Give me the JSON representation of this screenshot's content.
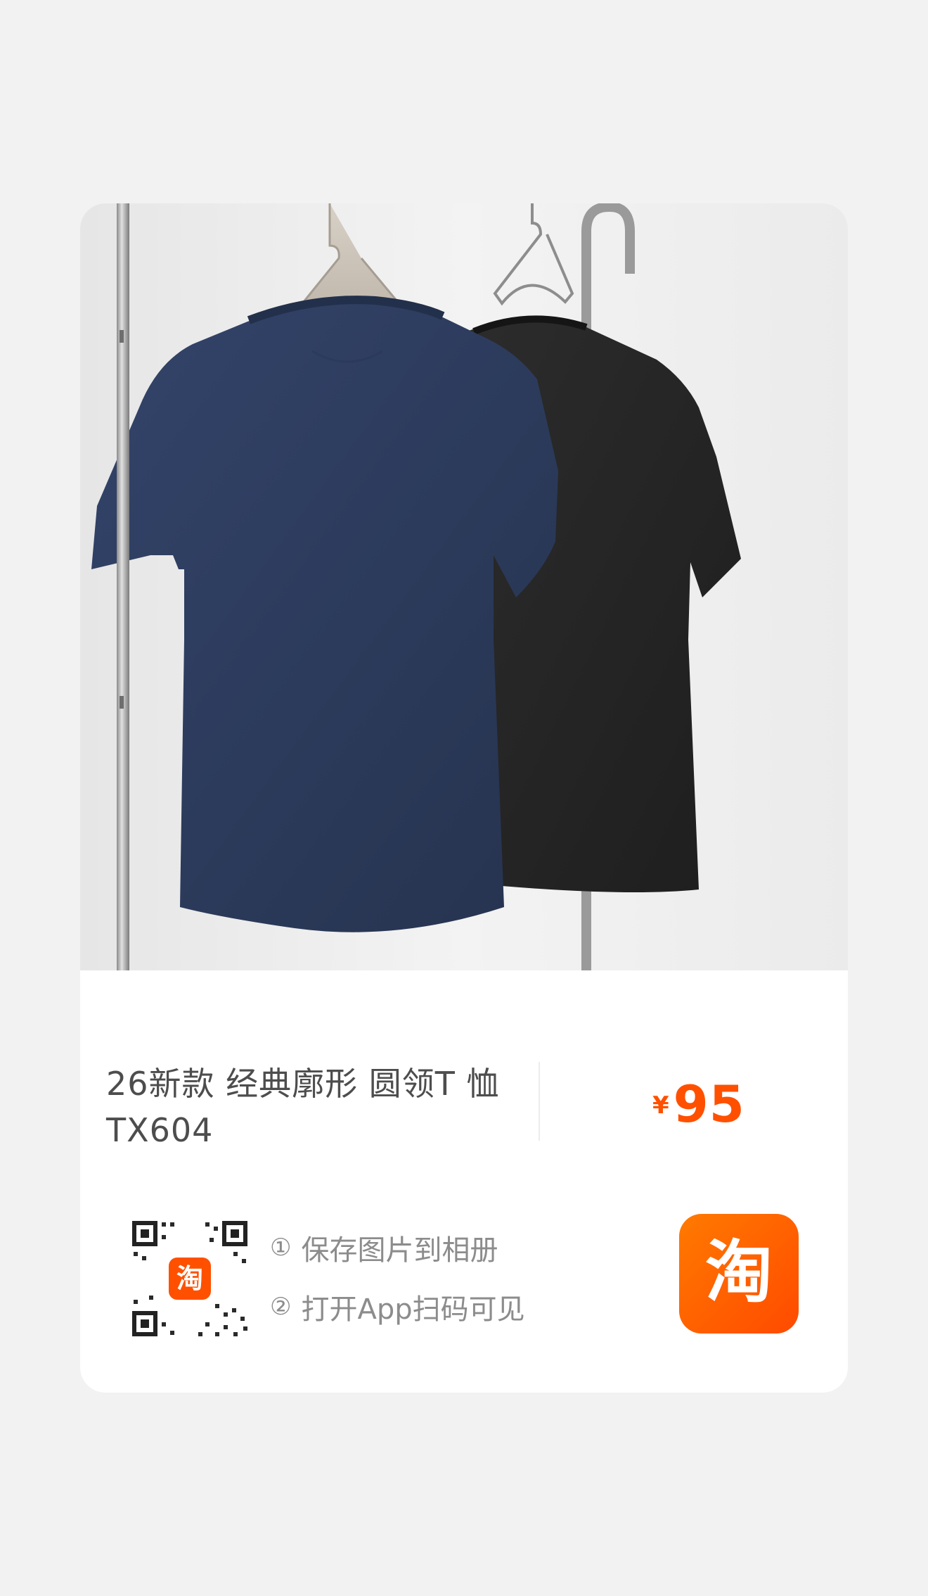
{
  "product": {
    "title": "26新款 经典廓形 圆领T 恤 TX604",
    "price": {
      "currency": "¥",
      "amount": "95"
    }
  },
  "share": {
    "steps": [
      {
        "num": "①",
        "text": "保存图片到相册"
      },
      {
        "num": "②",
        "text": "打开App扫码可见"
      }
    ],
    "qr_center_glyph": "淘",
    "app_logo_glyph": "淘",
    "app_logo_icon": "taobao-logo-icon"
  },
  "colors": {
    "background": "#f2f2f2",
    "card": "#ffffff",
    "accent": "#ff5000",
    "title_text": "#4d4d4d",
    "muted_text": "#8c8c8c",
    "shirt_navy": "#2e3d5f",
    "shirt_black": "#262626"
  }
}
